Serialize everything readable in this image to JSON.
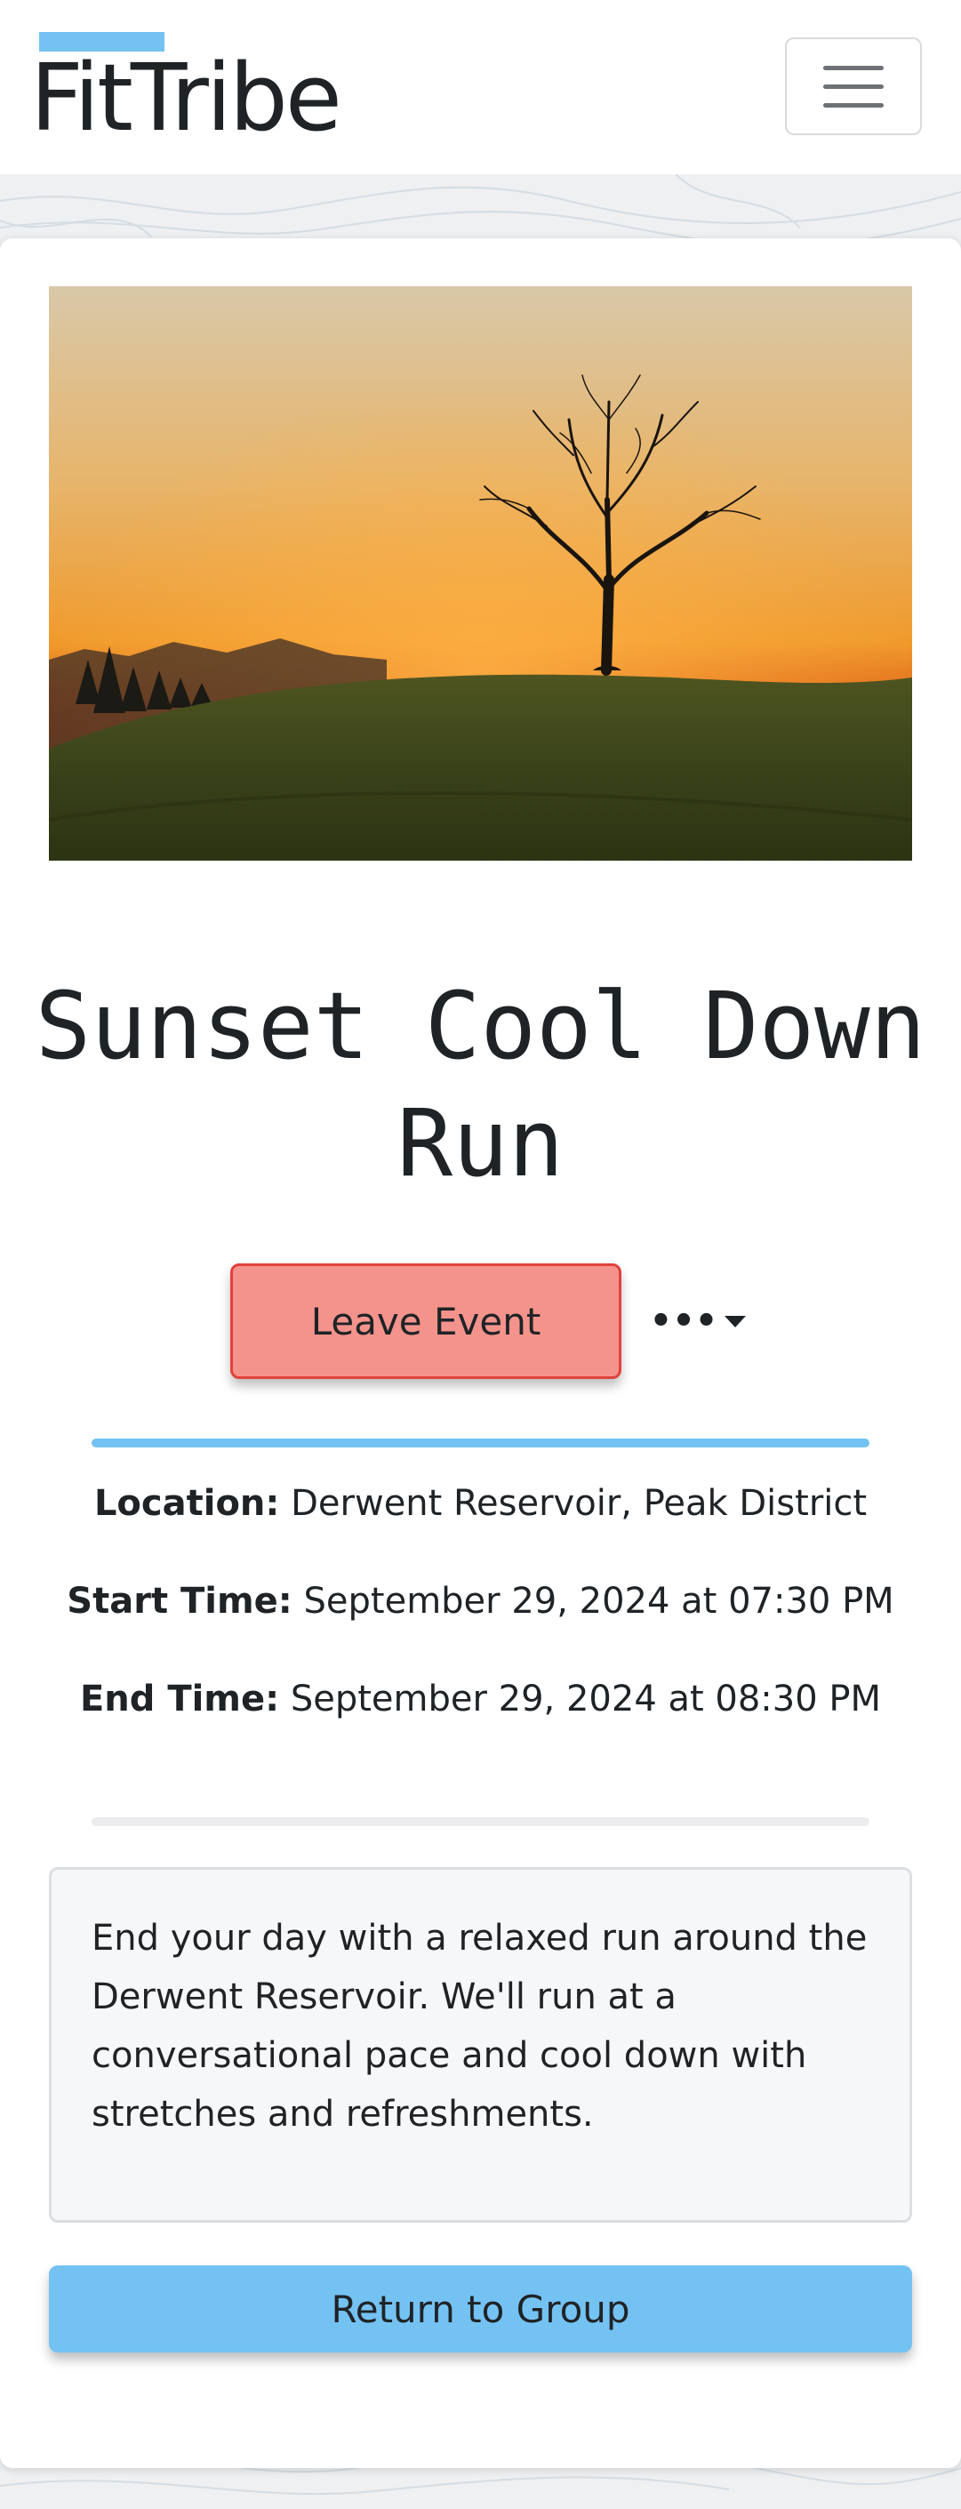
{
  "brand": {
    "name": "FitTribe"
  },
  "event": {
    "title": "Sunset Cool Down Run",
    "image_alt": "Sunset over a grassy hill with a lone tree",
    "leave_label": "Leave Event",
    "more_label": "•••",
    "location_label": "Location:",
    "location": "Derwent Reservoir, Peak District",
    "start_label": "Start Time:",
    "start": "September 29, 2024 at 07:30 PM",
    "end_label": "End Time:",
    "end": "September 29, 2024 at 08:30 PM",
    "description": "End your day with a relaxed run around the Derwent Reservoir. We'll run at a conversational pace and cool down with stretches and refreshments.",
    "return_label": "Return to Group"
  },
  "icons": {
    "menu": "hamburger-menu-icon",
    "more": "ellipsis-icon",
    "caret": "caret-down-icon"
  },
  "colors": {
    "accent": "#74c2f2",
    "danger_bg": "#f4938c",
    "danger_border": "#e0423c",
    "description_bg": "#f6f7f9"
  }
}
